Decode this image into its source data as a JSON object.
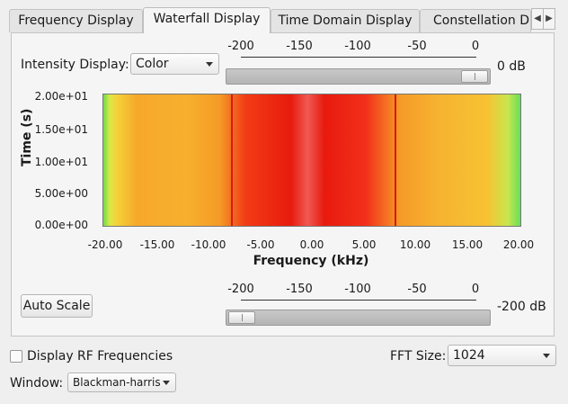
{
  "tabs": [
    {
      "label": "Frequency Display",
      "active": false
    },
    {
      "label": "Waterfall Display",
      "active": true
    },
    {
      "label": "Time Domain Display",
      "active": false
    },
    {
      "label": "Constellation Di",
      "active": false
    }
  ],
  "tab_scroll": {
    "left": "◀",
    "right": "▶"
  },
  "intensity": {
    "label": "Intensity Display:",
    "value": "Color"
  },
  "top_scale": {
    "ticks": [
      "-200",
      "-150",
      "-100",
      "-50",
      "0"
    ],
    "value_label": "0 dB",
    "value": 0
  },
  "bottom_scale": {
    "ticks": [
      "-200",
      "-150",
      "-100",
      "-50",
      "0"
    ],
    "value_label": "-200 dB",
    "value": -200
  },
  "plot": {
    "ylabel": "Time (s)",
    "xlabel": "Frequency (kHz)",
    "yticks": [
      "2.00e+01",
      "1.50e+01",
      "1.00e+01",
      "5.00e+00",
      "0.00e+00"
    ],
    "xticks": [
      "-20.00",
      "-15.00",
      "-10.00",
      "-5.00",
      "0.00",
      "5.00",
      "10.00",
      "15.00",
      "20.00"
    ],
    "xlim": [
      -20,
      20
    ],
    "ylim": [
      0,
      20
    ],
    "markers_khz": [
      -8,
      8
    ]
  },
  "auto_scale_label": "Auto Scale",
  "rf_checkbox": {
    "label": "Display RF Frequencies",
    "checked": false
  },
  "fft": {
    "label": "FFT Size:",
    "value": "1024"
  },
  "window": {
    "label": "Window:",
    "value": "Blackman-harris"
  }
}
